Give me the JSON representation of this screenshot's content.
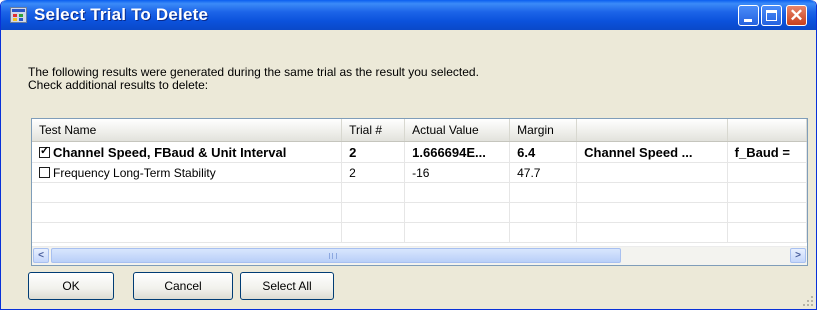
{
  "window": {
    "title": "Select Trial To Delete",
    "controls": {
      "minimize": "minimize",
      "maximize": "maximize",
      "close": "close"
    }
  },
  "message": {
    "line1": "The following results were generated during the same trial as the result you selected.",
    "line2": "Check additional results to delete:"
  },
  "grid": {
    "columns": [
      "Test Name",
      "Trial #",
      "Actual Value",
      "Margin",
      "",
      ""
    ],
    "rows": [
      {
        "checked": true,
        "bold": true,
        "cells": [
          "Channel Speed, FBaud & Unit Interval",
          "2",
          "1.666694E...",
          "6.4",
          "Channel Speed ...",
          "f_Baud ="
        ]
      },
      {
        "checked": false,
        "bold": false,
        "cells": [
          "Frequency Long-Term Stability",
          "2",
          "-16",
          "47.7",
          "",
          ""
        ]
      }
    ]
  },
  "buttons": {
    "ok": "OK",
    "cancel": "Cancel",
    "select_all": "Select All"
  },
  "colors": {
    "titlebar": "#0b52dc",
    "dialog_bg": "#ece9d8",
    "grid_border": "#7f9db9"
  }
}
